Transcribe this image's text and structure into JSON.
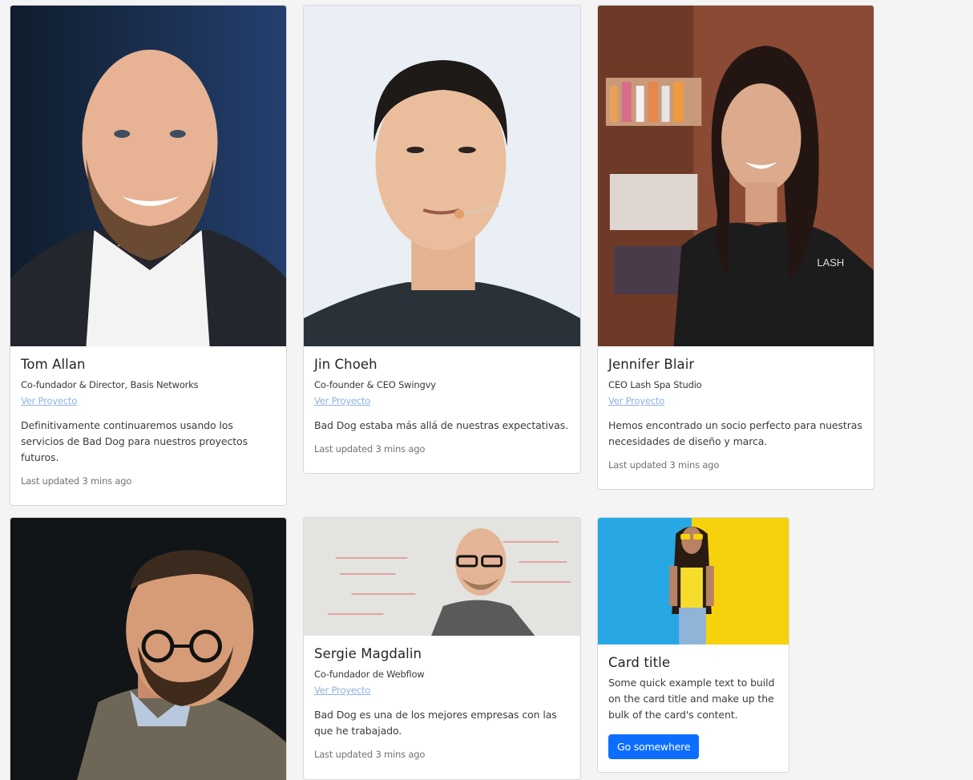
{
  "cards": [
    {
      "name": "Tom Allan",
      "role": "Co-fundador & Director, Basis Networks",
      "link": "Ver Proyecto",
      "text": "Definitivamente continuaremos usando los servicios de Bad Dog para nuestros proyectos futuros.",
      "updated": "Last updated 3 mins ago"
    },
    {
      "name": "Jin Choeh",
      "role": "Co-founder & CEO Swingvy",
      "link": "Ver Proyecto",
      "text": "Bad Dog estaba más allá de nuestras expectativas.",
      "updated": "Last updated 3 mins ago"
    },
    {
      "name": "Jennifer Blair",
      "role": "CEO Lash Spa Studio",
      "link": "Ver Proyecto",
      "text": "Hemos encontrado un socio perfecto para nuestras necesidades de diseño y marca.",
      "updated": "Last updated 3 mins ago"
    },
    {
      "name": "Sergie Magdalin",
      "role": "Co-fundador de Webflow",
      "link": "Ver Proyecto",
      "text": "Bad Dog es una de los mejores empresas con las que he trabajado.",
      "updated": "Last updated 3 mins ago"
    }
  ],
  "example_card": {
    "title": "Card title",
    "text": "Some quick example text to build on the card title and make up the bulk of the card's content.",
    "button": "Go somewhere"
  },
  "colors": {
    "primary": "#0d6efd",
    "link": "#8eb1e3",
    "background": "#f4f4f4"
  }
}
